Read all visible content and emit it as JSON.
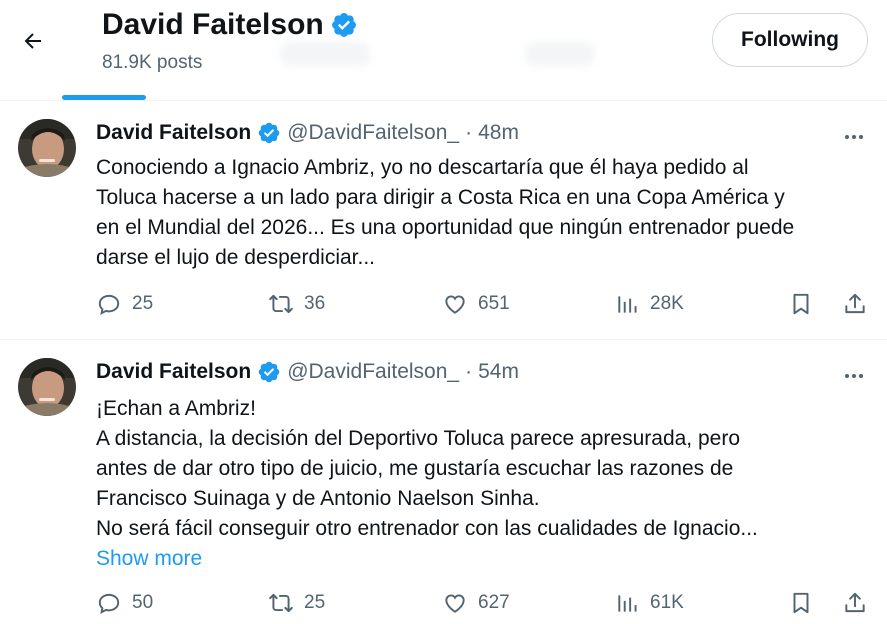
{
  "header": {
    "back_icon": "arrow-left-icon",
    "profile_name": "David Faitelson",
    "post_count": "81.9K posts",
    "follow_label": "Following",
    "accent_color": "#1d9bf0"
  },
  "tweets": [
    {
      "name": "David Faitelson",
      "handle": "@DavidFaitelson_",
      "dot": "·",
      "time": "48m",
      "lines": [
        "Conociendo a Ignacio Ambriz, yo no descartaría que él haya pedido al",
        "Toluca hacerse a un lado para dirigir a Costa Rica en una Copa América y",
        "en el Mundial del 2026... Es una oportunidad que ningún entrenador puede",
        "darse el lujo de desperdiciar..."
      ],
      "replies": "25",
      "retweets": "36",
      "likes": "651",
      "views": "28K"
    },
    {
      "name": "David Faitelson",
      "handle": "@DavidFaitelson_",
      "dot": "·",
      "time": "54m",
      "lines": [
        "¡Echan a Ambriz!",
        "A distancia, la decisión del Deportivo Toluca parece apresurada, pero",
        "antes de dar otro tipo de juicio, me gustaría escuchar las razones de",
        "Francisco Suinaga y de Antonio Naelson Sinha.",
        "No será fácil conseguir otro entrenador con las cualidades de Ignacio..."
      ],
      "show_more": "Show more",
      "replies": "50",
      "retweets": "25",
      "likes": "627",
      "views": "61K"
    }
  ]
}
